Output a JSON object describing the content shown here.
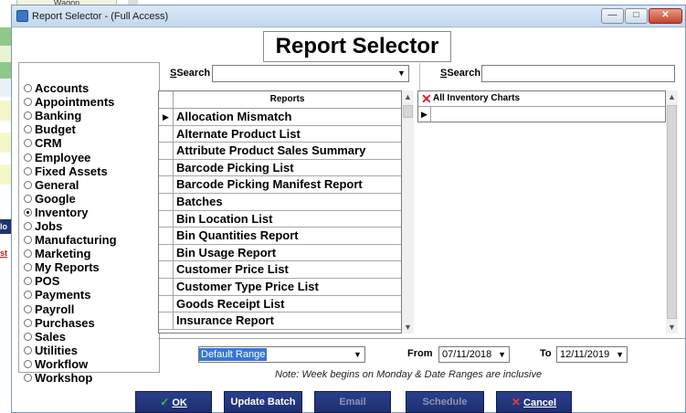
{
  "background_app": {
    "tab_label": "Wagon",
    "left_labels": [
      "lo",
      "st"
    ]
  },
  "window": {
    "title": "Report Selector - (Full Access)",
    "controls": {
      "minimize": "—",
      "maximize": "□",
      "close": "✕"
    }
  },
  "header": {
    "title": "Report Selector"
  },
  "categories": {
    "selected": "Inventory",
    "items": [
      "Accounts",
      "Appointments",
      "Banking",
      "Budget",
      "CRM",
      "Employee",
      "Fixed Assets",
      "General",
      "Google",
      "Inventory",
      "Jobs",
      "Manufacturing",
      "Marketing",
      "My Reports",
      "POS",
      "Payments",
      "Payroll",
      "Purchases",
      "Sales",
      "Utilities",
      "Workflow",
      "Workshop"
    ]
  },
  "search_left": {
    "label": "Search",
    "value": ""
  },
  "search_right": {
    "label": "Search",
    "value": ""
  },
  "reports_grid": {
    "column_header": "Reports",
    "rows": [
      "Allocation Mismatch",
      "Alternate Product List",
      "Attribute Product Sales Summary",
      "Barcode Picking List",
      "Barcode Picking Manifest Report",
      "Batches",
      "Bin Location List",
      "Bin Quantities Report",
      "Bin Usage Report",
      "Customer Price List",
      "Customer Type Price List",
      "Goods Receipt List",
      "Insurance Report"
    ]
  },
  "charts_grid": {
    "column_header": "All Inventory Charts"
  },
  "date_range": {
    "range_value": "Default Range",
    "from_label": "From",
    "from_value": "07/11/2018",
    "to_label": "To",
    "to_value": "12/11/2019",
    "note": "Note: Week begins on Monday  &  Date Ranges are inclusive"
  },
  "buttons": {
    "ok": "OK",
    "update_batch": "Update Batch",
    "email": "Email",
    "schedule": "Schedule",
    "cancel": "Cancel"
  },
  "colors": {
    "button_bg": "#23357a",
    "selection_blue": "#3875d7",
    "title_bar": "#c3d8ee"
  }
}
